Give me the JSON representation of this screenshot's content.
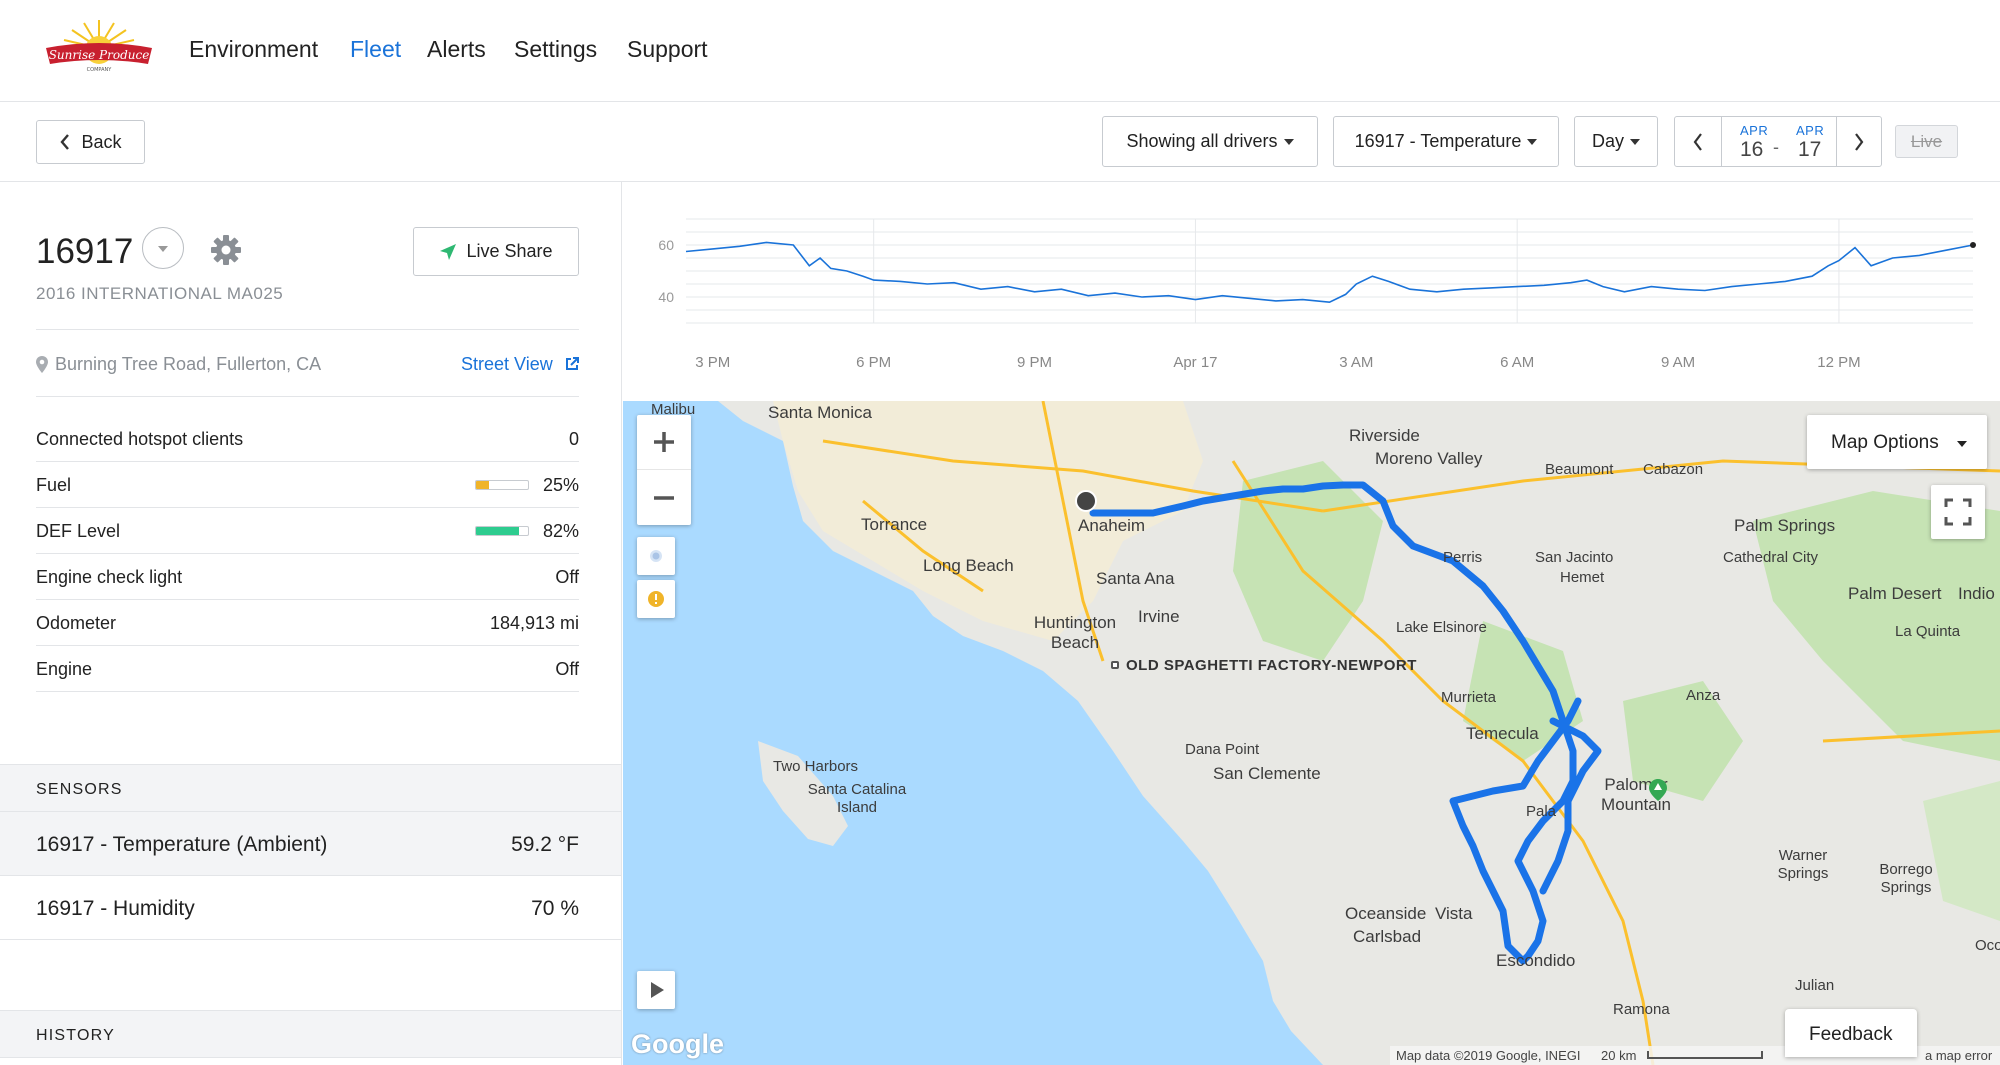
{
  "nav": {
    "items": [
      {
        "label": "Environment",
        "active": false
      },
      {
        "label": "Fleet",
        "active": true
      },
      {
        "label": "Alerts",
        "active": false
      },
      {
        "label": "Settings",
        "active": false
      },
      {
        "label": "Support",
        "active": false
      }
    ],
    "active_color": "#1a73d9"
  },
  "toolbar": {
    "back_label": "Back",
    "drivers_select": "Showing all drivers",
    "sensor_select": "16917 - Temperature",
    "range_select": "Day",
    "date_from": {
      "month": "APR",
      "day": "16"
    },
    "date_sep": "-",
    "date_to": {
      "month": "APR",
      "day": "17"
    },
    "live_label": "Live"
  },
  "vehicle": {
    "id": "16917",
    "model": "2016 INTERNATIONAL MA025",
    "share_label": "Live Share",
    "location": "Burning Tree Road, Fullerton, CA",
    "street_view": "Street View",
    "stats": [
      {
        "label": "Connected hotspot clients",
        "value": "0"
      },
      {
        "label": "Fuel",
        "value": "25%",
        "level": 0.25,
        "bar_color": "#f0b429"
      },
      {
        "label": "DEF Level",
        "value": "82%",
        "level": 0.82,
        "bar_color": "#2ecc8f"
      },
      {
        "label": "Engine check light",
        "value": "Off"
      },
      {
        "label": "Odometer",
        "value": "184,913 mi"
      },
      {
        "label": "Engine",
        "value": "Off"
      }
    ]
  },
  "sensors": {
    "header": "SENSORS",
    "items": [
      {
        "label": "16917 - Temperature (Ambient)",
        "value": "59.2 °F",
        "highlight": true
      },
      {
        "label": "16917 - Humidity",
        "value": "70 %",
        "highlight": false
      }
    ]
  },
  "history": {
    "header": "HISTORY"
  },
  "chart_data": {
    "type": "line",
    "x_tick_labels": [
      "3 PM",
      "6 PM",
      "9 PM",
      "Apr 17",
      "3 AM",
      "6 AM",
      "9 AM",
      "12 PM"
    ],
    "y_tick_labels": [
      "40",
      "60"
    ],
    "ylim": [
      30,
      70
    ],
    "xlim": [
      14.5,
      38.5
    ],
    "grid": true,
    "line_color": "#1a73d9",
    "series": [
      {
        "x": [
          14.5,
          15.0,
          15.5,
          16.0,
          16.5,
          16.8,
          17.0,
          17.2,
          17.5,
          17.8,
          18.0,
          18.5,
          19.0,
          19.5,
          20.0,
          20.5,
          21.0,
          21.5,
          22.0,
          22.5,
          23.0,
          23.5,
          24.0,
          24.5,
          25.0,
          25.5,
          26.0,
          26.5,
          26.8,
          27.0,
          27.3,
          27.6,
          28.0,
          28.5,
          29.0,
          29.5,
          30.0,
          30.5,
          31.0,
          31.3,
          31.6,
          32.0,
          32.5,
          33.0,
          33.5,
          34.0,
          34.5,
          35.0,
          35.5,
          35.8,
          36.0,
          36.3,
          36.6,
          37.0,
          37.5,
          38.0,
          38.5
        ],
        "y": [
          57.5,
          58.5,
          59.5,
          61,
          60,
          52,
          55,
          51,
          50,
          48,
          46.5,
          46,
          45,
          45.5,
          43,
          44,
          42,
          43,
          40.5,
          41.5,
          40,
          40.5,
          39,
          40.5,
          39.5,
          38.5,
          39,
          38,
          41,
          45,
          48,
          46,
          43,
          42,
          43,
          43.5,
          44,
          44.5,
          45.5,
          46.5,
          44,
          42,
          44,
          43,
          42.5,
          44,
          45,
          46,
          48,
          52,
          54,
          59,
          52,
          55,
          56,
          58,
          60
        ]
      }
    ]
  },
  "map": {
    "options_label": "Map Options",
    "feedback_label": "Feedback",
    "attribution": "Map data ©2019 Google, INEGI",
    "scale_label": "20 km",
    "error_label": "a map error",
    "google_logo": "Google",
    "poi_label": "OLD SPAGHETTI FACTORY-NEWPORT",
    "places": [
      "Malibu",
      "Santa Monica",
      "Torrance",
      "Long Beach",
      "Anaheim",
      "Santa Ana",
      "Huntington Beach",
      "Irvine",
      "Riverside",
      "Moreno Valley",
      "Beaumont",
      "Cabazon",
      "Palm Springs",
      "Cathedral City",
      "Palm Desert",
      "Indio",
      "La Quinta",
      "Perris",
      "San Jacinto",
      "Hemet",
      "Lake Elsinore",
      "Murrieta",
      "Temecula",
      "Anza",
      "Palomar Mountain",
      "Dana Point",
      "San Clemente",
      "Two Harbors",
      "Santa Catalina Island",
      "Oceanside",
      "Vista",
      "Carlsbad",
      "Escondido",
      "Warner Springs",
      "Borrego Springs",
      "Julian",
      "Ramona",
      "Oco",
      "Pala"
    ],
    "route_color": "#1a73e8"
  }
}
